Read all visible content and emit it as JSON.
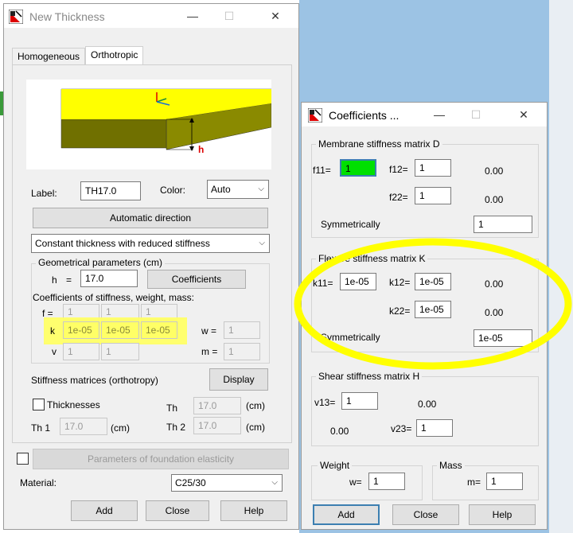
{
  "left_dialog": {
    "title": "New Thickness",
    "tabs": [
      "Homogeneous",
      "Orthotropic"
    ],
    "active_tab": "Orthotropic",
    "label_caption": "Label:",
    "label_value": "TH17.0",
    "color_caption": "Color:",
    "color_value": "Auto",
    "automatic_direction": "Automatic direction",
    "thickness_type": "Constant thickness with reduced stiffness",
    "geom_group_title": "Geometrical parameters (cm)",
    "h_label": "h",
    "h_eq": "=",
    "h_value": "17.0",
    "coefficients_button": "Coefficients",
    "coef_caption": "Coefficients of stiffness, weight, mass:",
    "f_label": "f =",
    "f_values": [
      "1",
      "1",
      "1"
    ],
    "k_label": "k",
    "k_values": [
      "1e-05",
      "1e-05",
      "1e-05"
    ],
    "v_label": "v",
    "v_values": [
      "1",
      "1"
    ],
    "w_label": "w =",
    "w_value": "1",
    "m_label": "m =",
    "m_value": "1",
    "stiffness_caption": "Stiffness matrices (orthotropy)",
    "display_button": "Display",
    "thicknesses_label": "Thicknesses",
    "th_label": "Th",
    "th_value": "17.0",
    "th_unit": "(cm)",
    "th1_label": "Th 1",
    "th1_value": "17.0",
    "th1_unit": "(cm)",
    "th2_label": "Th 2",
    "th2_value": "17.0",
    "th2_unit": "(cm)",
    "foundation_button": "Parameters of foundation elasticity",
    "material_caption": "Material:",
    "material_value": "C25/30",
    "add": "Add",
    "close": "Close",
    "help": "Help",
    "preview_h_label": "h"
  },
  "right_dialog": {
    "title": "Coefficients ...",
    "membrane_title": "Membrane stiffness matrix D",
    "f11_label": "f11=",
    "f11_value": "1",
    "f12_label": "f12=",
    "f12_value": "1",
    "f21_value": "0.00",
    "f22_label": "f22=",
    "f22_value": "1",
    "f22_side": "0.00",
    "sym_label": "Symmetrically",
    "sym_value": "1",
    "flexure_title": "Flexure stiffness matrix K",
    "k11_label": "k11=",
    "k11_value": "1e-05",
    "k12_label": "k12=",
    "k12_value": "1e-05",
    "k21_value": "0.00",
    "k22_label": "k22=",
    "k22_value": "1e-05",
    "k22_side": "0.00",
    "sym2_label": "Symmetrically",
    "sym2_value": "1e-05",
    "shear_title": "Shear stiffness matrix H",
    "v13_label": "v13=",
    "v13_value": "1",
    "v13_side": "0.00",
    "v31_value": "0.00",
    "v23_label": "v23=",
    "v23_value": "1",
    "weight_title": "Weight",
    "w_label": "w=",
    "w_value": "1",
    "mass_title": "Mass",
    "m_label": "m=",
    "m_value": "1",
    "add": "Add",
    "close": "Close",
    "help": "Help"
  },
  "colors": {
    "highlight": "#ffff00",
    "active_input": "#00e000",
    "accent_border": "#3c7fb1"
  }
}
